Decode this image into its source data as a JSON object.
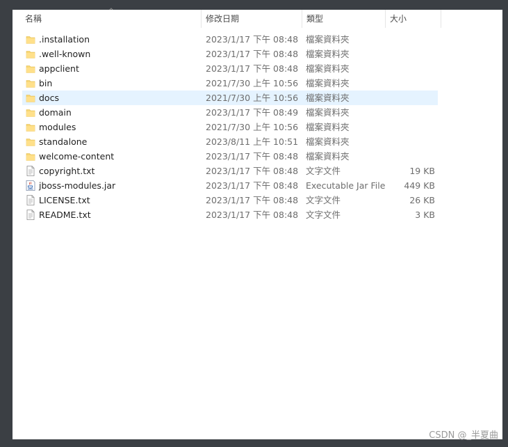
{
  "columns": {
    "name": "名稱",
    "date": "修改日期",
    "type": "類型",
    "size": "大小"
  },
  "files": [
    {
      "name": ".installation",
      "date": "2023/1/17 下午 08:48",
      "type": "檔案資料夾",
      "size": "",
      "icon": "folder-icon"
    },
    {
      "name": ".well-known",
      "date": "2023/1/17 下午 08:48",
      "type": "檔案資料夾",
      "size": "",
      "icon": "folder-icon"
    },
    {
      "name": "appclient",
      "date": "2023/1/17 下午 08:48",
      "type": "檔案資料夾",
      "size": "",
      "icon": "folder-icon"
    },
    {
      "name": "bin",
      "date": "2021/7/30 上午 10:56",
      "type": "檔案資料夾",
      "size": "",
      "icon": "folder-icon"
    },
    {
      "name": "docs",
      "date": "2021/7/30 上午 10:56",
      "type": "檔案資料夾",
      "size": "",
      "icon": "folder-icon",
      "selected": true
    },
    {
      "name": "domain",
      "date": "2023/1/17 下午 08:49",
      "type": "檔案資料夾",
      "size": "",
      "icon": "folder-icon"
    },
    {
      "name": "modules",
      "date": "2021/7/30 上午 10:56",
      "type": "檔案資料夾",
      "size": "",
      "icon": "folder-icon"
    },
    {
      "name": "standalone",
      "date": "2023/8/11 上午 10:51",
      "type": "檔案資料夾",
      "size": "",
      "icon": "folder-icon"
    },
    {
      "name": "welcome-content",
      "date": "2023/1/17 下午 08:48",
      "type": "檔案資料夾",
      "size": "",
      "icon": "folder-icon"
    },
    {
      "name": "copyright.txt",
      "date": "2023/1/17 下午 08:48",
      "type": "文字文件",
      "size": "19 KB",
      "icon": "text-file-icon"
    },
    {
      "name": "jboss-modules.jar",
      "date": "2023/1/17 下午 08:48",
      "type": "Executable Jar File",
      "size": "449 KB",
      "icon": "jar-file-icon"
    },
    {
      "name": "LICENSE.txt",
      "date": "2023/1/17 下午 08:48",
      "type": "文字文件",
      "size": "26 KB",
      "icon": "text-file-icon"
    },
    {
      "name": "README.txt",
      "date": "2023/1/17 下午 08:48",
      "type": "文字文件",
      "size": "3 KB",
      "icon": "text-file-icon"
    }
  ],
  "watermark": "CSDN @_半夏曲",
  "colors": {
    "selection": "#e5f3ff",
    "folder": "#f8d775",
    "background": "#3b3f44"
  }
}
